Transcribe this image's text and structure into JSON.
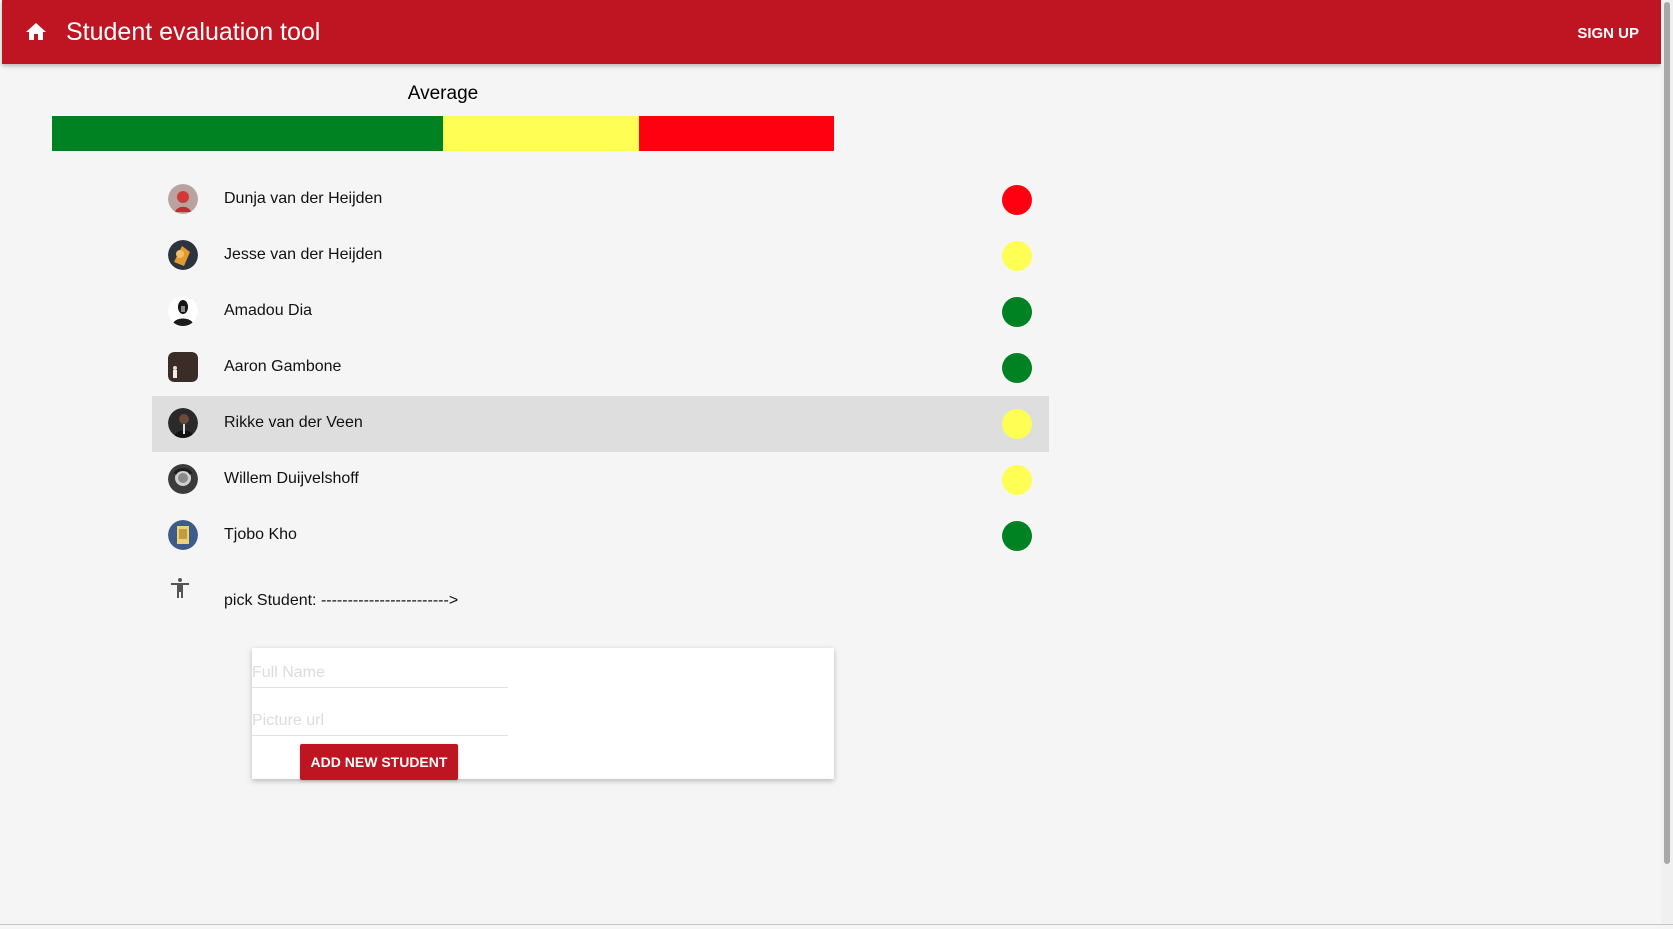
{
  "header": {
    "home_icon": "home-icon",
    "title": "Student evaluation tool",
    "signup_label": "SIGN UP"
  },
  "average": {
    "label": "Average",
    "distribution": [
      {
        "status": "green",
        "count": 4,
        "color": "#008122"
      },
      {
        "status": "yellow",
        "count": 2,
        "color": "#fffe54"
      },
      {
        "status": "red",
        "count": 2,
        "color": "#ff0011"
      }
    ]
  },
  "students": [
    {
      "name": "Dunja van der Heijden",
      "status": "red",
      "color": "#ff0011"
    },
    {
      "name": "Jesse van der Heijden",
      "status": "yellow",
      "color": "#fffe54"
    },
    {
      "name": "Amadou Dia",
      "status": "green",
      "color": "#008122"
    },
    {
      "name": "Aaron Gambone",
      "status": "green",
      "color": "#008122"
    },
    {
      "name": "Rikke van der Veen",
      "status": "yellow",
      "color": "#fffe54",
      "selected": true
    },
    {
      "name": "Willem Duijvelshoff",
      "status": "yellow",
      "color": "#fffe54"
    },
    {
      "name": "Tjobo Kho",
      "status": "green",
      "color": "#008122"
    }
  ],
  "pick": {
    "icon": "accessibility-icon",
    "text": "pick Student: ------------------------>"
  },
  "add_form": {
    "full_name_placeholder": "Full Name",
    "picture_url_placeholder": "Picture url",
    "button_label": "ADD NEW STUDENT"
  },
  "colors": {
    "primary": "#bf1421",
    "green": "#008122",
    "yellow": "#fffe54",
    "red": "#ff0011"
  }
}
